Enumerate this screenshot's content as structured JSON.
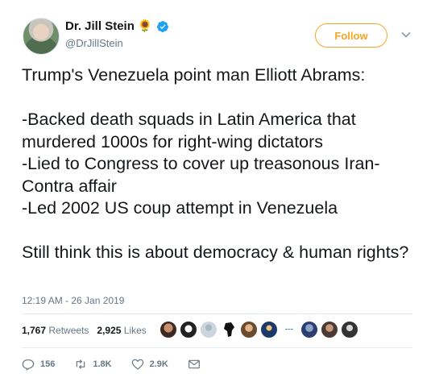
{
  "user": {
    "name": "Dr. Jill Stein",
    "handle": "@DrJillStein"
  },
  "follow_label": "Follow",
  "tweet": {
    "lines": [
      "Trump's Venezuela point man Elliott Abrams:",
      "-Backed death squads in Latin America that murdered 1000s for right-wing dictators",
      "-Lied to Congress to cover up treasonous Iran-Contra affair",
      "-Led 2002 US coup attempt in Venezuela",
      "Still think this is about democracy & human rights?"
    ],
    "timestamp": "12:19 AM - 26 Jan 2019"
  },
  "stats": {
    "retweets_count": "1,767",
    "retweets_label": "Retweets",
    "likes_count": "2,925",
    "likes_label": "Likes"
  },
  "actions": {
    "replies": "156",
    "retweets": "1.8K",
    "likes": "2.9K"
  },
  "colors": {
    "accent": "#f5a623",
    "verified": "#1da1f2",
    "muted": "#657786"
  }
}
